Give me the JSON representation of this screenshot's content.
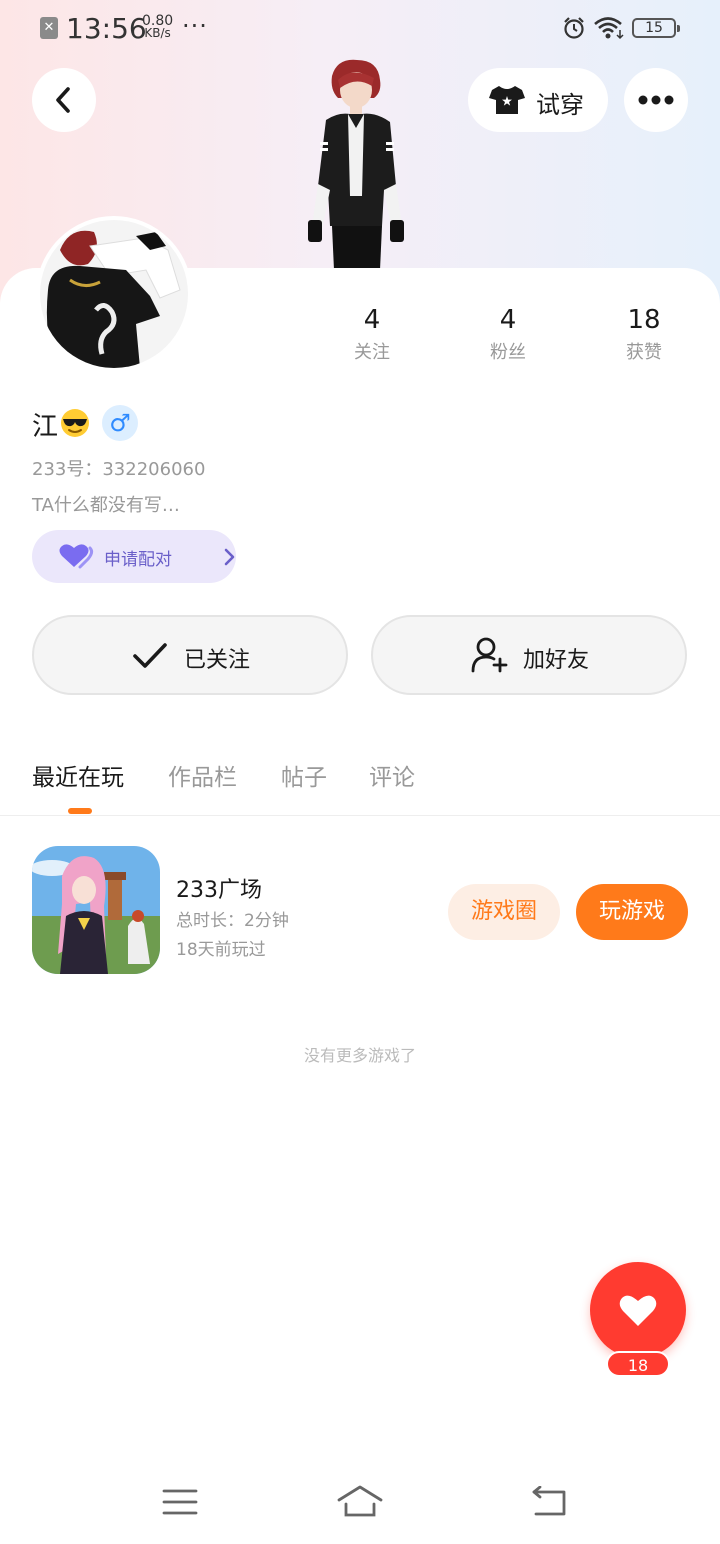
{
  "status_bar": {
    "time": "13:56",
    "net_speed_value": "0.80",
    "net_speed_unit": "KB/s",
    "overflow": "···",
    "battery": "15"
  },
  "top_bar": {
    "try_on_label": "试穿"
  },
  "profile": {
    "stats": [
      {
        "value": "4",
        "label": "关注"
      },
      {
        "value": "4",
        "label": "粉丝"
      },
      {
        "value": "18",
        "label": "获赞"
      }
    ],
    "name": "江",
    "gender_symbol": "♂",
    "id_text": "233号：332206060",
    "bio": "TA什么都没有写…",
    "pair_label": "申请配对"
  },
  "actions": {
    "follow_label": "已关注",
    "add_friend_label": "加好友"
  },
  "tabs": [
    {
      "label": "最近在玩",
      "active": true
    },
    {
      "label": "作品栏",
      "active": false
    },
    {
      "label": "帖子",
      "active": false
    },
    {
      "label": "评论",
      "active": false
    }
  ],
  "games": [
    {
      "title": "233广场",
      "duration": "总时长：2分钟",
      "last_played": "18天前玩过",
      "circle_label": "游戏圈",
      "play_label": "玩游戏"
    }
  ],
  "empty_hint": "没有更多游戏了",
  "likes": {
    "count": "18"
  },
  "colors": {
    "accent_orange": "#ff7a1a",
    "like_red": "#ff3b30",
    "pair_purple": "#6a5fc9",
    "gender_blue": "#2f8bff"
  }
}
